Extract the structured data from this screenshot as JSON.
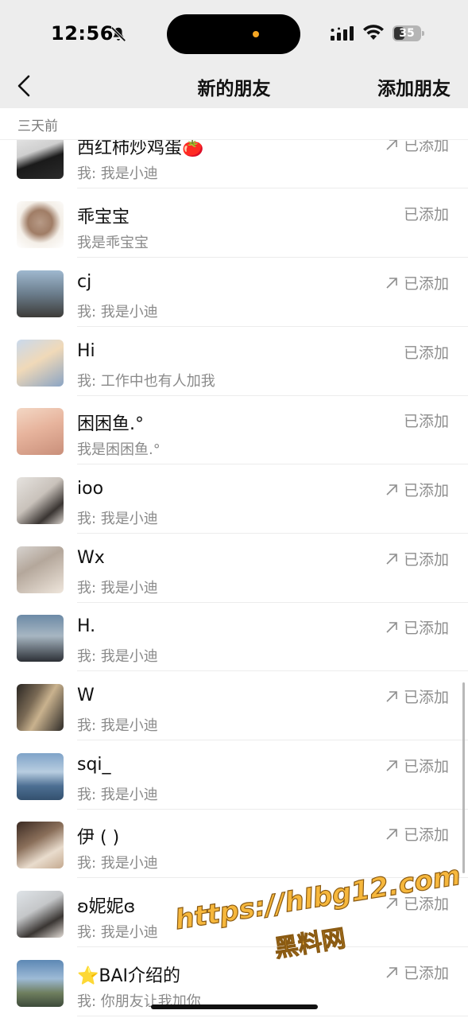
{
  "status_bar": {
    "time": "12:56",
    "battery_text": "35",
    "icons": [
      "bell-slash-icon",
      "signal-icon",
      "wifi-icon",
      "battery-icon"
    ]
  },
  "nav": {
    "back_icon": "chevron-left-icon",
    "title": "新的朋友",
    "action": "添加朋友"
  },
  "section": {
    "label": "三天前"
  },
  "friends": [
    {
      "name": "西红柿炒鸡蛋🍅",
      "message": "我: 我是小迪",
      "status": "已添加",
      "shared_arrow": true
    },
    {
      "name": "乖宝宝",
      "message": "我是乖宝宝",
      "status": "已添加",
      "shared_arrow": false
    },
    {
      "name": "cj",
      "message": "我: 我是小迪",
      "status": "已添加",
      "shared_arrow": true
    },
    {
      "name": "Hi",
      "message": "我: 工作中也有人加我",
      "status": "已添加",
      "shared_arrow": false
    },
    {
      "name": "困困鱼.°",
      "message": "我是困困鱼.°",
      "status": "已添加",
      "shared_arrow": false
    },
    {
      "name": "ioo",
      "message": "我: 我是小迪",
      "status": "已添加",
      "shared_arrow": true
    },
    {
      "name": "Wx",
      "message": "我: 我是小迪",
      "status": "已添加",
      "shared_arrow": true
    },
    {
      "name": "H.",
      "message": "我: 我是小迪",
      "status": "已添加",
      "shared_arrow": true
    },
    {
      "name": "W",
      "message": "我: 我是小迪",
      "status": "已添加",
      "shared_arrow": true
    },
    {
      "name": "sqi_",
      "message": "我: 我是小迪",
      "status": "已添加",
      "shared_arrow": true
    },
    {
      "name": "伊 ( )",
      "message": "我: 我是小迪",
      "status": "已添加",
      "shared_arrow": true
    },
    {
      "name": "ʚ妮妮ɞ",
      "message": "我: 我是小迪",
      "status": "已添加",
      "shared_arrow": true
    },
    {
      "name": "⭐BAI介绍的",
      "message": "我: 你朋友让我加你",
      "status": "已添加",
      "shared_arrow": true
    }
  ],
  "watermark": {
    "url": "https://hlbg12.com",
    "text": "黑料网"
  }
}
